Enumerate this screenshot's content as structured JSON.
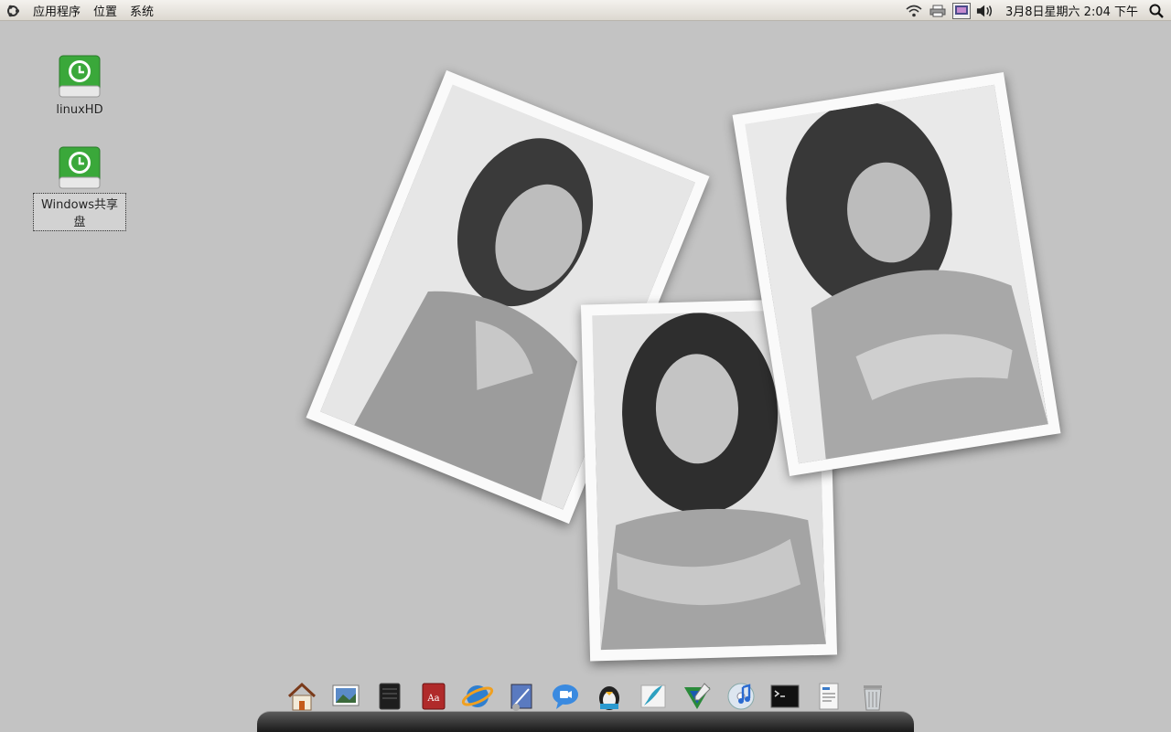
{
  "panel": {
    "menus": [
      "应用程序",
      "位置",
      "系统"
    ],
    "clock": "3月8日星期六  2:04 下午",
    "tray_icons": [
      "wifi-icon",
      "printer-icon",
      "display-icon",
      "volume-icon"
    ],
    "search_icon": "search-icon"
  },
  "desktop": {
    "icons": [
      {
        "label": "linuxHD",
        "icon": "drive-icon"
      },
      {
        "label": "Windows共享盘",
        "icon": "drive-icon",
        "selected": true
      }
    ]
  },
  "wallpaper": {
    "photos": [
      "photo-left",
      "photo-center",
      "photo-right"
    ]
  },
  "dock": {
    "items": [
      "home-icon",
      "image-viewer-icon",
      "notebook-icon",
      "dictionary-icon",
      "browser-icon",
      "mail-icon",
      "chat-icon",
      "penguin-icon",
      "feather-icon",
      "vector-app-icon",
      "music-icon",
      "terminal-icon",
      "document-icon",
      "trash-icon"
    ]
  },
  "colors": {
    "desktop_bg": "#c3c3c3",
    "drive_green": "#3aa83a"
  }
}
